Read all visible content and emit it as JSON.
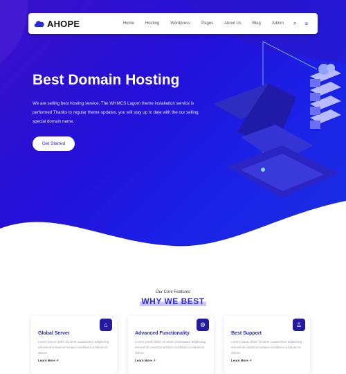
{
  "brand": {
    "name": "AHOPE"
  },
  "nav": {
    "items": [
      "Home",
      "Hosting",
      "Wordpress",
      "Pages",
      "About Us",
      "Blog",
      "Admin"
    ],
    "search_icon": "search-icon",
    "menu_icon": "hamburger-icon"
  },
  "hero": {
    "title": "Best Domain Hosting",
    "description": "We are selling best hosting service, The WHMCS Lagom theme installation service is performed Thanks to regular theme updates, you will stay up to date with the our selling special domain name.",
    "cta_label": "Get Started"
  },
  "features": {
    "subtitle": "Our Core Features",
    "title": "WHY WE BEST",
    "cards": [
      {
        "title": "Global Server",
        "text": "Lorem ipsum dolor sit amet consectetur adipiscing elit sed do eiusmod tempor incididunt ut labore et dolore.",
        "link": "Learn More ↗",
        "icon": "server-icon"
      },
      {
        "title": "Advanced Functionality",
        "text": "Lorem ipsum dolor sit amet consectetur adipiscing elit sed do eiusmod tempor incididunt ut labore et dolore.",
        "link": "Learn More ↗",
        "icon": "settings-icon"
      },
      {
        "title": "Best Support",
        "text": "Lorem ipsum dolor sit amet consectetur adipiscing elit sed do eiusmod tempor incididunt ut labore et dolore.",
        "link": "Learn More ↗",
        "icon": "support-icon"
      }
    ]
  },
  "colors": {
    "primary": "#2a1acb",
    "accent": "#2d2ad6",
    "hero_start": "#3a12c9",
    "hero_end": "#1b2fe0"
  }
}
